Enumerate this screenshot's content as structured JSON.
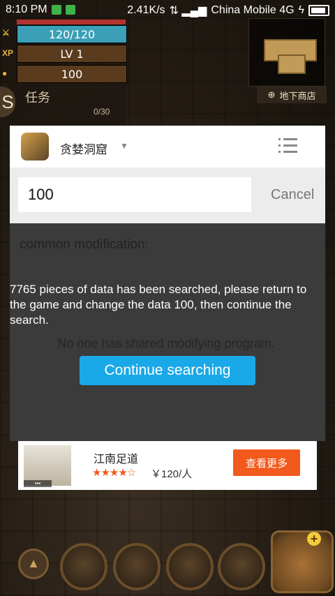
{
  "status_bar": {
    "time": "8:10 PM",
    "speed": "2.41K/s",
    "carrier": "China Mobile 4G"
  },
  "game": {
    "hp": "120/120",
    "level": "LV 1",
    "gold": "100",
    "xp_label": "XP",
    "quest_title": "任务",
    "quest_count": "0/30",
    "map_label": "地下商店"
  },
  "dialog": {
    "app_name": "贪婪洞窟",
    "search_value": "100",
    "cancel_label": "Cancel",
    "common_modification": "common modification:",
    "result_message": "7765 pieces of data has been searched, please return to the game and change the data 100, then continue the search.",
    "no_share": "No one has shared modifying program.",
    "continue_label": "Continue searching"
  },
  "ad": {
    "title": "江南足道",
    "rating": 3.5,
    "price": "￥120/人",
    "button_label": "查看更多"
  }
}
